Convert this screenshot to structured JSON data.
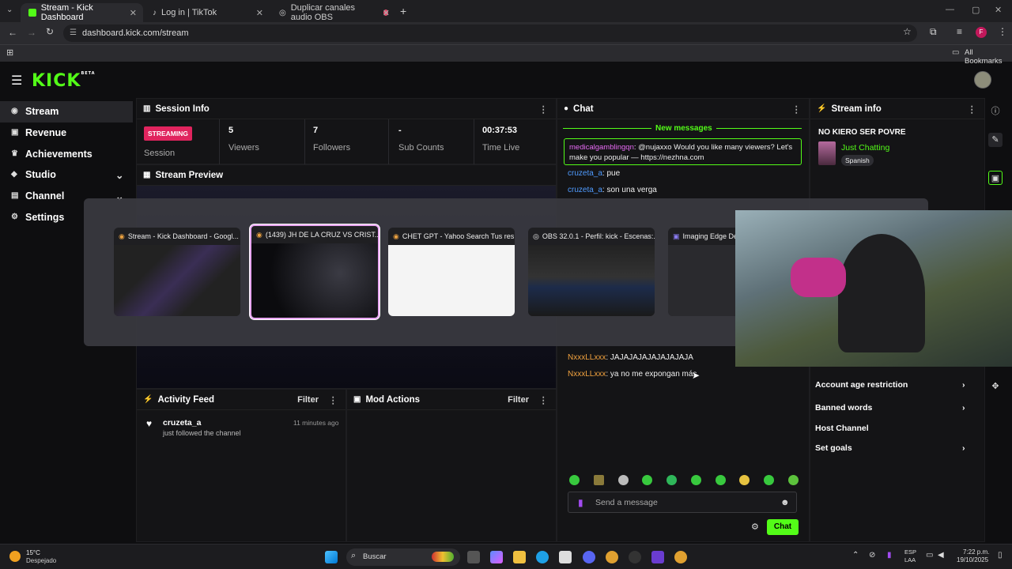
{
  "browser": {
    "tabs": [
      {
        "label": "Stream - Kick Dashboard"
      },
      {
        "label": "Log in | TikTok"
      },
      {
        "label": "Duplicar canales audio OBS"
      }
    ],
    "url": "dashboard.kick.com/stream",
    "bookmarks_label": "All Bookmarks"
  },
  "app": {
    "logo": "KICK",
    "logo_badge": "BETA"
  },
  "sidebar": {
    "items": [
      {
        "label": "Stream"
      },
      {
        "label": "Revenue"
      },
      {
        "label": "Achievements"
      },
      {
        "label": "Studio"
      },
      {
        "label": "Channel"
      },
      {
        "label": "Settings"
      }
    ]
  },
  "session": {
    "title": "Session Info",
    "streaming_badge": "STREAMING",
    "session_label": "Session",
    "stats": [
      {
        "value": "5",
        "label": "Viewers"
      },
      {
        "value": "7",
        "label": "Followers"
      },
      {
        "value": "-",
        "label": "Sub Counts"
      },
      {
        "value": "00:37:53",
        "label": "Time Live"
      }
    ]
  },
  "preview": {
    "title": "Stream Preview"
  },
  "chat": {
    "title": "Chat",
    "new_messages": "New messages",
    "highlight": {
      "user": "medicalgamblingqn",
      "text": ": @nujaxxo Would you like many viewers? Let's make you popular — https://nezhna.com"
    },
    "lines": [
      {
        "user": "cruzeta_a",
        "text": ": pue"
      },
      {
        "user": "cruzeta_a",
        "text": ": son una verga"
      },
      {
        "user": "NxxxLLxxx",
        "text": ": JAJAJAJAJAJAJAJAJA"
      },
      {
        "user": "NxxxLLxxx",
        "text": ": ya no me expongan más"
      }
    ],
    "placeholder": "Send a message",
    "send_label": "Chat"
  },
  "stream_info": {
    "title": "Stream info",
    "stream_title": "NO KIERO SER POVRE",
    "category": "Just Chatting",
    "language": "Spanish",
    "settings": [
      {
        "label": "Account age restriction",
        "arrow": true
      },
      {
        "label": "Banned words",
        "arrow": true
      },
      {
        "label": "Host Channel",
        "arrow": false
      },
      {
        "label": "Set goals",
        "arrow": true
      }
    ]
  },
  "activity": {
    "title": "Activity Feed",
    "filter": "Filter",
    "items": [
      {
        "user": "cruzeta_a",
        "text": "just followed the channel",
        "time": "11 minutes ago"
      }
    ]
  },
  "mod": {
    "title": "Mod Actions",
    "filter": "Filter"
  },
  "switcher": {
    "windows": [
      {
        "title": "Stream - Kick Dashboard - Googl..."
      },
      {
        "title": "(1439) JH DE LA CRUZ VS CRIST..."
      },
      {
        "title": "CHET GPT - Yahoo Search Tus res..."
      },
      {
        "title": "OBS 32.0.1 - Perfil: kick - Escenas:..."
      },
      {
        "title": "Imaging Edge De..."
      }
    ]
  },
  "taskbar": {
    "weather_temp": "15°C",
    "weather_desc": "Despejado",
    "search": "Buscar",
    "lang": "ESP",
    "lang2": "LAA",
    "time": "7:22 p.m.",
    "date": "19/10/2025"
  }
}
